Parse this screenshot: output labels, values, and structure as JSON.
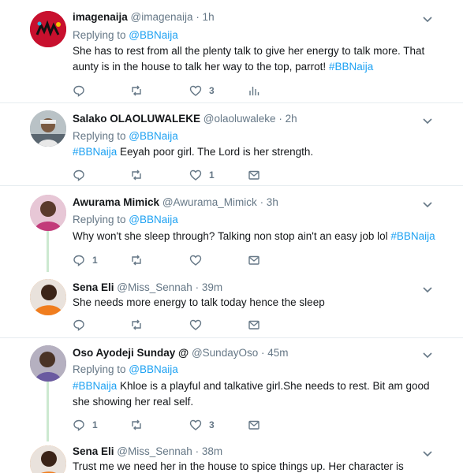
{
  "tweets": [
    {
      "name": "imagenaija",
      "handle": "@imagenaija",
      "time": "· 1h",
      "replying_prefix": "Replying to ",
      "replying_to": "@BBNaija",
      "text": "She has to rest from all the plenty talk to give her energy to talk more. That aunty is in the house to talk her way to the top, parrot! ",
      "hashtag": "#BBNaija",
      "likes": "3"
    },
    {
      "name": "Salako OLAOLUWALEKE",
      "handle": "@olaoluwaleke",
      "time": "· 2h",
      "replying_prefix": "Replying to ",
      "replying_to": "@BBNaija",
      "hashtag": "#BBNaija",
      "text": " Eeyah poor girl. The Lord is her strength.",
      "likes": "1"
    },
    {
      "name": "Awurama Mimick",
      "handle": "@Awurama_Mimick",
      "time": "· 3h",
      "replying_prefix": "Replying to ",
      "replying_to": "@BBNaija",
      "text": "Why won't she sleep through? Talking non stop ain't an easy job lol ",
      "hashtag": "#BBNaija",
      "replies": "1"
    },
    {
      "name": "Sena Eli",
      "handle": "@Miss_Sennah",
      "time": "· 39m",
      "text": "She needs more energy to talk today hence the sleep"
    },
    {
      "name": "Oso Ayodeji Sunday @",
      "handle": "@SundayOso",
      "time": "· 45m",
      "replying_prefix": "Replying to ",
      "replying_to": "@BBNaija",
      "hashtag": "#BBNaija",
      "text": " Khloe is a playful and talkative girl.She needs to rest. Bit am good she showing her real self.",
      "replies": "1",
      "likes": "3"
    },
    {
      "name": "Sena Eli",
      "handle": "@Miss_Sennah",
      "time": "· 38m",
      "text": "Trust me we need her in the house to spice things up. Her character is annoying"
    }
  ],
  "colors": {
    "accent": "#1da1f2",
    "muted": "#657786",
    "thread": "#cce9d0",
    "divider": "#e6ecf0"
  },
  "icons": [
    "reply-icon",
    "retweet-icon",
    "like-icon",
    "analytics-icon",
    "message-icon",
    "chevron-down-icon"
  ]
}
